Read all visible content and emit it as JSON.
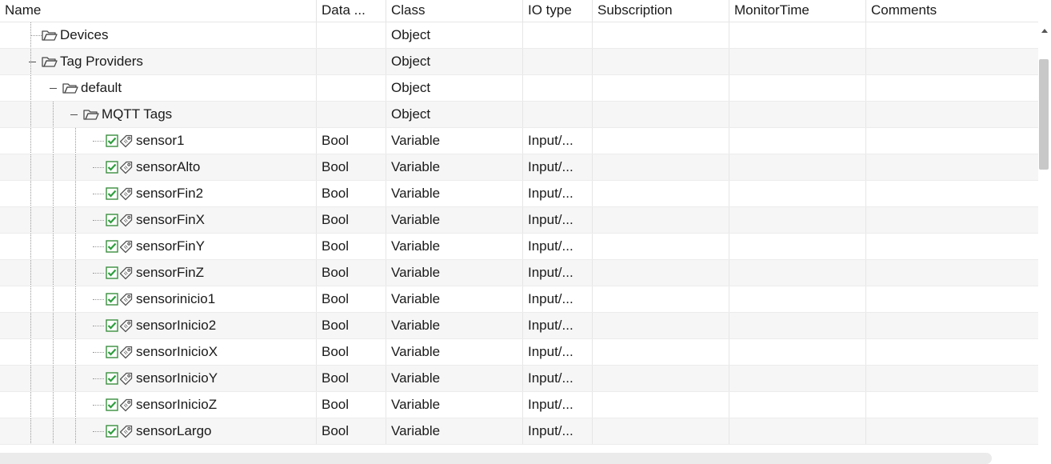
{
  "columns": [
    "Name",
    "Data ...",
    "Class",
    "IO type",
    "Subscription",
    "MonitorTime",
    "Comments"
  ],
  "rows": [
    {
      "name": "Devices",
      "kind": "folder",
      "level": 1,
      "expander": false,
      "data_type": "",
      "class": "Object",
      "io_type": "",
      "subscription": "",
      "monitor_time": "",
      "comments": ""
    },
    {
      "name": "Tag Providers",
      "kind": "folder",
      "level": 1,
      "expander": true,
      "data_type": "",
      "class": "Object",
      "io_type": "",
      "subscription": "",
      "monitor_time": "",
      "comments": ""
    },
    {
      "name": "default",
      "kind": "folder",
      "level": 2,
      "expander": true,
      "data_type": "",
      "class": "Object",
      "io_type": "",
      "subscription": "",
      "monitor_time": "",
      "comments": ""
    },
    {
      "name": "MQTT Tags",
      "kind": "folder",
      "level": 3,
      "expander": true,
      "data_type": "",
      "class": "Object",
      "io_type": "",
      "subscription": "",
      "monitor_time": "",
      "comments": ""
    },
    {
      "name": "sensor1",
      "kind": "tag",
      "level": 4,
      "checked": true,
      "data_type": "Bool",
      "class": "Variable",
      "io_type": "Input/...",
      "subscription": "",
      "monitor_time": "",
      "comments": ""
    },
    {
      "name": "sensorAlto",
      "kind": "tag",
      "level": 4,
      "checked": true,
      "data_type": "Bool",
      "class": "Variable",
      "io_type": "Input/...",
      "subscription": "",
      "monitor_time": "",
      "comments": ""
    },
    {
      "name": "sensorFin2",
      "kind": "tag",
      "level": 4,
      "checked": true,
      "data_type": "Bool",
      "class": "Variable",
      "io_type": "Input/...",
      "subscription": "",
      "monitor_time": "",
      "comments": ""
    },
    {
      "name": "sensorFinX",
      "kind": "tag",
      "level": 4,
      "checked": true,
      "data_type": "Bool",
      "class": "Variable",
      "io_type": "Input/...",
      "subscription": "",
      "monitor_time": "",
      "comments": ""
    },
    {
      "name": "sensorFinY",
      "kind": "tag",
      "level": 4,
      "checked": true,
      "data_type": "Bool",
      "class": "Variable",
      "io_type": "Input/...",
      "subscription": "",
      "monitor_time": "",
      "comments": ""
    },
    {
      "name": "sensorFinZ",
      "kind": "tag",
      "level": 4,
      "checked": true,
      "data_type": "Bool",
      "class": "Variable",
      "io_type": "Input/...",
      "subscription": "",
      "monitor_time": "",
      "comments": ""
    },
    {
      "name": "sensorinicio1",
      "kind": "tag",
      "level": 4,
      "checked": true,
      "data_type": "Bool",
      "class": "Variable",
      "io_type": "Input/...",
      "subscription": "",
      "monitor_time": "",
      "comments": ""
    },
    {
      "name": "sensorInicio2",
      "kind": "tag",
      "level": 4,
      "checked": true,
      "data_type": "Bool",
      "class": "Variable",
      "io_type": "Input/...",
      "subscription": "",
      "monitor_time": "",
      "comments": ""
    },
    {
      "name": "sensorInicioX",
      "kind": "tag",
      "level": 4,
      "checked": true,
      "data_type": "Bool",
      "class": "Variable",
      "io_type": "Input/...",
      "subscription": "",
      "monitor_time": "",
      "comments": ""
    },
    {
      "name": "sensorInicioY",
      "kind": "tag",
      "level": 4,
      "checked": true,
      "data_type": "Bool",
      "class": "Variable",
      "io_type": "Input/...",
      "subscription": "",
      "monitor_time": "",
      "comments": ""
    },
    {
      "name": "sensorInicioZ",
      "kind": "tag",
      "level": 4,
      "checked": true,
      "data_type": "Bool",
      "class": "Variable",
      "io_type": "Input/...",
      "subscription": "",
      "monitor_time": "",
      "comments": ""
    },
    {
      "name": "sensorLargo",
      "kind": "tag",
      "level": 4,
      "checked": true,
      "data_type": "Bool",
      "class": "Variable",
      "io_type": "Input/...",
      "subscription": "",
      "monitor_time": "",
      "comments": ""
    }
  ],
  "colors": {
    "checkbox": "#2e9e3e",
    "tree_lines": "#9a9a9a",
    "alt_row": "#f6f6f6"
  },
  "icons": {
    "folder": "folder-icon",
    "tag": "tag-icon",
    "checked": "checkbox-checked-icon",
    "expander": "collapse-minus-icon"
  }
}
